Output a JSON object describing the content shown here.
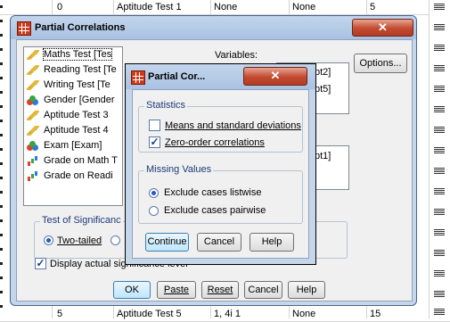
{
  "background": {
    "top_row": [
      "0",
      "Aptitude Test 1",
      "None",
      "None",
      "5"
    ],
    "bottom_row": [
      "5",
      "Aptitude Test 5",
      "1, 4i 1",
      "None",
      "15"
    ]
  },
  "dialog": {
    "title": "Partial Correlations",
    "close_symbol": "✕",
    "variables_label": "Variables:",
    "options_button": "Options...",
    "variable_list": [
      {
        "label": "Maths Test [Tes",
        "icon": "scale-ruler-icon",
        "selected": true
      },
      {
        "label": "Reading Test [Te",
        "icon": "scale-ruler-icon"
      },
      {
        "label": "Writing Test [Te",
        "icon": "scale-ruler-icon"
      },
      {
        "label": "Gender [Gender",
        "icon": "nominal-icon"
      },
      {
        "label": "Aptitude Test 3",
        "icon": "scale-ruler-icon"
      },
      {
        "label": "Aptitude Test 4",
        "icon": "scale-ruler-icon"
      },
      {
        "label": "Exam [Exam]",
        "icon": "nominal-icon"
      },
      {
        "label": "Grade on Math T",
        "icon": "ordinal-icon"
      },
      {
        "label": "Grade on Readi",
        "icon": "ordinal-icon"
      }
    ],
    "variables_box_fragments": [
      "pt2]",
      "pt5]"
    ],
    "controlling_box_fragment": "pt1]",
    "significance_group": "Test of Significanc",
    "two_tailed": "Two-tailed",
    "display_sig": "Display actual significance level",
    "buttons": {
      "ok": "OK",
      "paste": "Paste",
      "reset": "Reset",
      "cancel": "Cancel",
      "help": "Help"
    }
  },
  "options": {
    "title": "Partial Cor...",
    "close_symbol": "✕",
    "statistics_group": "Statistics",
    "means_sd": "Means and standard deviations",
    "means_checked": false,
    "zero_order": "Zero-order correlations",
    "zero_order_checked": true,
    "missing_group": "Missing Values",
    "listwise": "Exclude cases listwise",
    "pairwise": "Exclude cases pairwise",
    "selected_missing": "listwise",
    "buttons": {
      "continue": "Continue",
      "cancel": "Cancel",
      "help": "Help"
    }
  }
}
